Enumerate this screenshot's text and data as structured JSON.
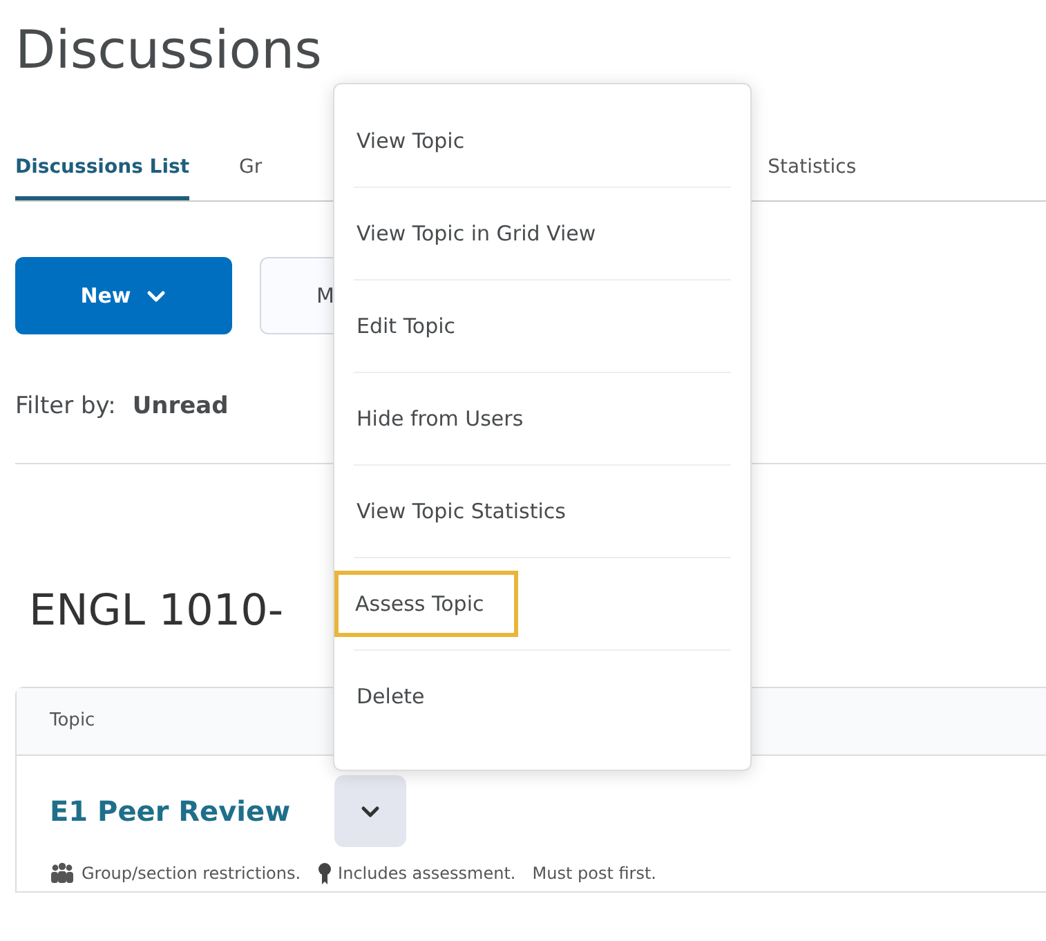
{
  "page_title": "Discussions",
  "tabs": [
    {
      "label": "Discussions List",
      "selected": true
    },
    {
      "label": "Gr",
      "selected": false
    },
    {
      "label": "Statistics",
      "selected": false
    }
  ],
  "toolbar": {
    "new_button": "New",
    "button_2": "M"
  },
  "filter": {
    "label": "Filter by:",
    "value": "Unread"
  },
  "section_heading": "ENGL 1010-",
  "table": {
    "columns": [
      "Topic"
    ],
    "rows": [
      {
        "title": "E1 Peer Review",
        "meta": [
          {
            "kind": "group",
            "text": "Group/section restrictions."
          },
          {
            "kind": "assessment",
            "text": "Includes assessment."
          },
          {
            "kind": "plain",
            "text": "Must post first."
          }
        ]
      }
    ]
  },
  "context_menu": {
    "items": [
      {
        "label": "View Topic",
        "highlighted": false
      },
      {
        "label": "View Topic in Grid View",
        "highlighted": false
      },
      {
        "label": "Edit Topic",
        "highlighted": false
      },
      {
        "label": "Hide from Users",
        "highlighted": false
      },
      {
        "label": "View Topic Statistics",
        "highlighted": false
      },
      {
        "label": "Assess Topic",
        "highlighted": true
      },
      {
        "label": "Delete",
        "highlighted": false
      }
    ]
  }
}
